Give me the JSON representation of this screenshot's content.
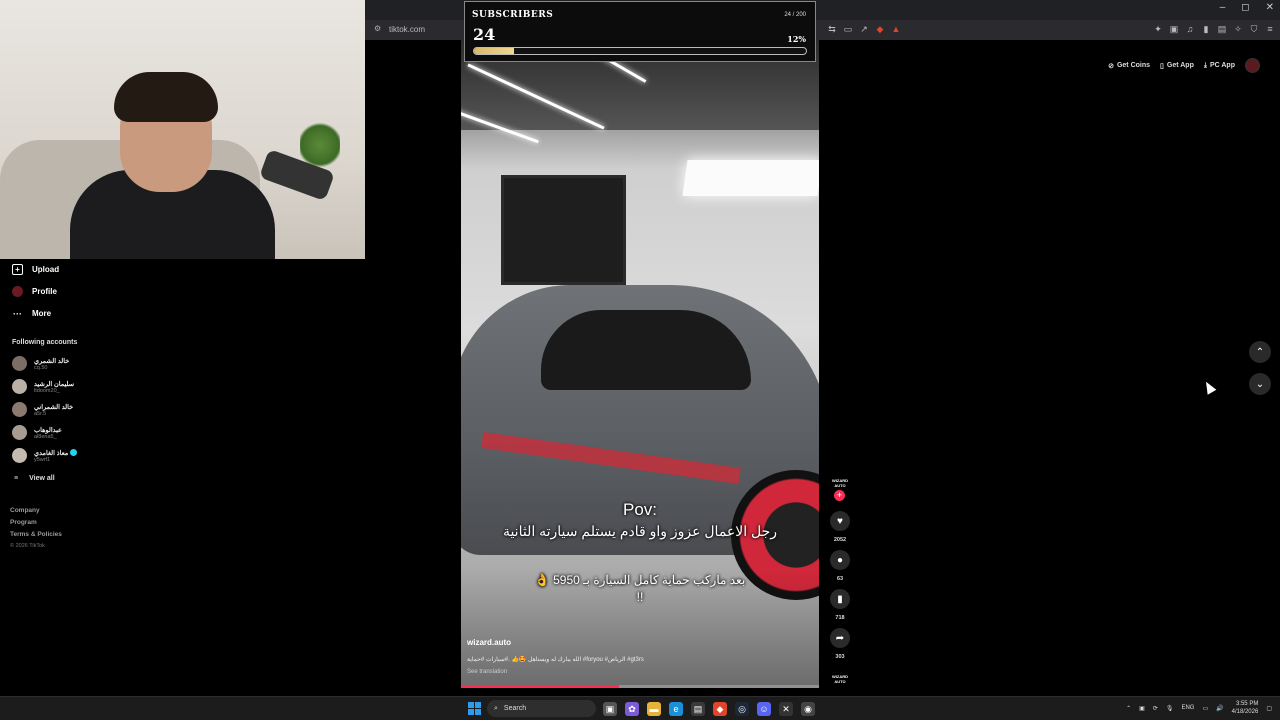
{
  "browser": {
    "url": "tiktok.com",
    "window_controls": [
      "–",
      "◻",
      "✕"
    ]
  },
  "sub_goal": {
    "title": "SUBSCRIBERS",
    "count": "24",
    "ratio": "24 / 200",
    "percent_label": "12%",
    "progress": 0.12
  },
  "sidebar": {
    "items": [
      {
        "label": "Upload",
        "icon": "plus-square-icon"
      },
      {
        "label": "Profile",
        "icon": "avatar-icon"
      },
      {
        "label": "More",
        "icon": "ellipsis-icon"
      }
    ],
    "following_title": "Following accounts",
    "accounts": [
      {
        "name": "خالد الشمري",
        "handle": "cq.50",
        "verified": false
      },
      {
        "name": "سليمان الرشيد",
        "handle": "ltdoom20_",
        "verified": false
      },
      {
        "name": "خالد الشمراني",
        "handle": "a5r.5",
        "verified": false
      },
      {
        "name": "عبدالوهاب",
        "handle": "al8ena5_",
        "verified": false
      },
      {
        "name": "معاذ الغامدي",
        "handle": "y5wrf1",
        "verified": true
      }
    ],
    "view_all": "View all",
    "footer": [
      "Company",
      "Program",
      "Terms & Policies"
    ],
    "copyright": "© 2026 TikTok"
  },
  "top_actions": {
    "get_coins": "Get Coins",
    "get_app": "Get App",
    "pc_app": "PC App"
  },
  "video": {
    "caption_title": "Pov:",
    "caption_line1": "رجل الاعمال عزوز واو قادم يستلم سيارته الثانية",
    "caption_line2": "بعد ماركب حماية كامل السيارة بـ 5950 👌 !!",
    "author": "wizard.auto",
    "description": "الله يبارك له ويستاهل 🤩👍 .#سيارات #حماية #foryou #الرياض #gt3rs",
    "see_translation": "See translation",
    "progress": 0.44
  },
  "actions": {
    "author_logo": "WIZARD AUTO",
    "likes": "2052",
    "comments": "63",
    "saves": "718",
    "shares": "303"
  },
  "taskbar": {
    "search_label": "Search",
    "lang": "ENG",
    "time": "3:55 PM",
    "date": "4/18/2026"
  },
  "colors": {
    "accent": "#fe2c55",
    "gold": "#e5c77b",
    "verified": "#20d5ec"
  }
}
